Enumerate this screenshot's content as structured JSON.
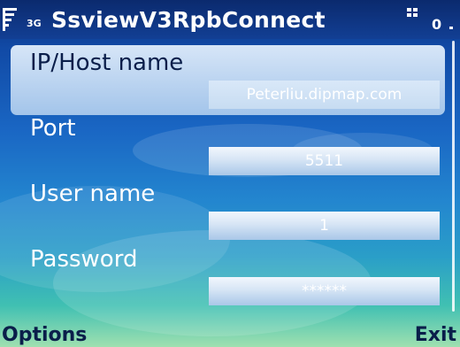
{
  "status_bar": {
    "app_title": "SsviewV3RpbConnect",
    "network_label": "3G",
    "battery_value": "0"
  },
  "form": {
    "fields": [
      {
        "label": "IP/Host name",
        "value": "Peterliu.dipmap.com",
        "selected": true
      },
      {
        "label": "Port",
        "value": "5511",
        "selected": false
      },
      {
        "label": "User name",
        "value": "1",
        "selected": false
      },
      {
        "label": "Password",
        "value": "******",
        "selected": false
      }
    ]
  },
  "softkeys": {
    "left": "Options",
    "right": "Exit"
  },
  "colors": {
    "title_bar": "#123f94",
    "background_top": "#114aa6",
    "background_bottom": "#9fe0b0",
    "softkey_text": "#0a1e4a"
  },
  "icons": [
    "signal-strength-icon",
    "battery-icon",
    "scrollbar-track"
  ]
}
